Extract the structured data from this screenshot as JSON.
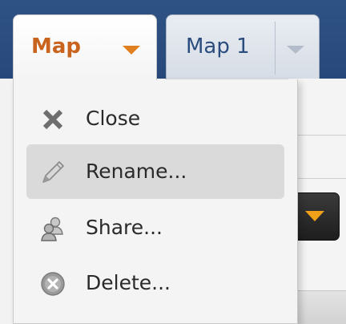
{
  "tabs": [
    {
      "label": "Map",
      "active": true,
      "color": "#c8641e"
    },
    {
      "label": "Map 1",
      "active": false,
      "color": "#2b4d7e"
    }
  ],
  "menu": {
    "items": [
      {
        "label": "Close",
        "icon": "close-icon"
      },
      {
        "label": "Rename...",
        "icon": "pencil-icon",
        "highlighted": true
      },
      {
        "label": "Share...",
        "icon": "users-icon"
      },
      {
        "label": "Delete...",
        "icon": "delete-circle-icon"
      }
    ]
  },
  "colors": {
    "tabbar_bg": "#2b4c7e",
    "accent_orange": "#e07f1f",
    "menu_bg": "#f4f4f4",
    "menu_hover": "#dadada"
  }
}
